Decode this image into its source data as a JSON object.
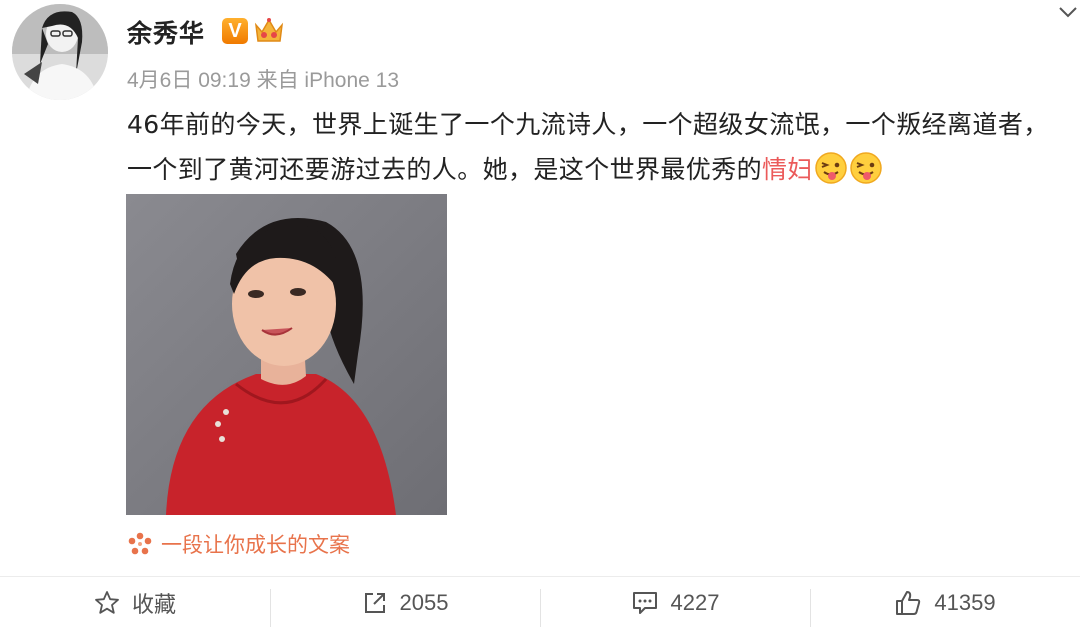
{
  "post": {
    "author": "余秀华",
    "verified_badge": "V",
    "meta": "4月6日 09:19 来自 iPhone 13",
    "text_main": "46年前的今天，世界上诞生了一个九流诗人，一个超级女流氓，一个叛经离道者，一个到了黄河还要游过去的人。她，是这个世界最优秀的",
    "text_highlight": "情妇",
    "source_label": "一段让你成长的文案"
  },
  "actions": {
    "favorite_label": "收藏",
    "repost_count": "2055",
    "comment_count": "4227",
    "like_count": "41359"
  },
  "colors": {
    "highlight": "#eb5a5a",
    "source": "#e8734b",
    "badge": "#f59a1b"
  },
  "icons": [
    "chevron-down-icon",
    "verified-icon",
    "crown-icon",
    "tongue-emoji-icon",
    "flower-icon",
    "star-icon",
    "repost-icon",
    "comment-icon",
    "like-icon"
  ]
}
